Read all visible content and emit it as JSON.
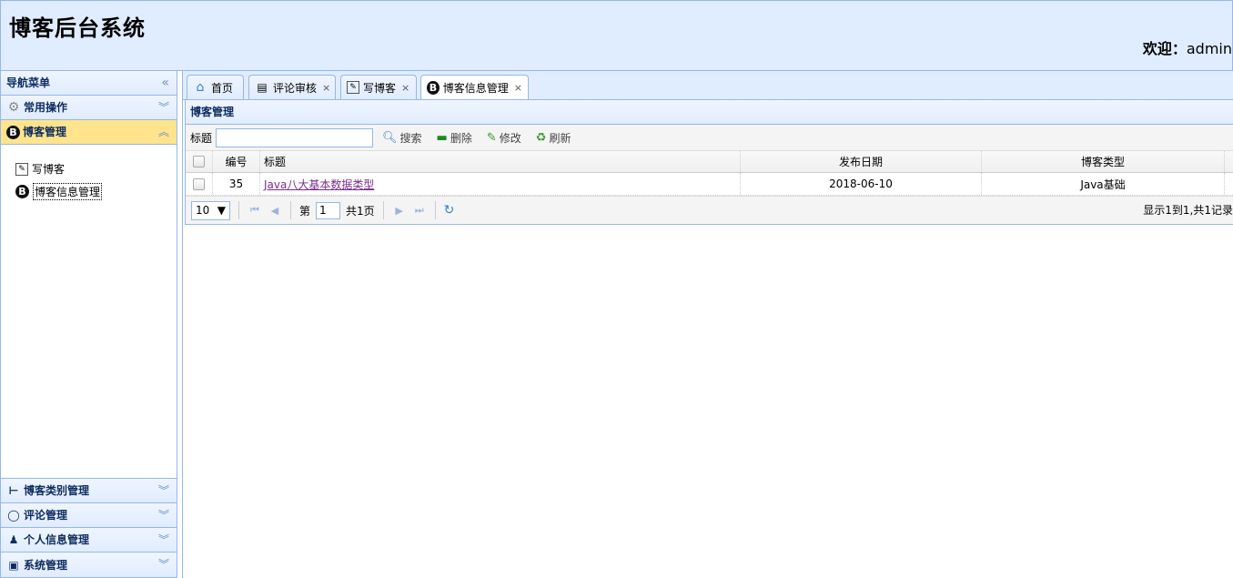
{
  "header": {
    "title": "博客后台系统",
    "welcome_prefix": "欢迎：",
    "user": "admin"
  },
  "sidebar": {
    "title": "导航菜单",
    "groups": [
      {
        "label": "常用操作",
        "icon": "gear-icon"
      },
      {
        "label": "博客管理",
        "icon": "blog-icon",
        "selected": true,
        "items": [
          {
            "label": "写博客",
            "icon": "edit-icon"
          },
          {
            "label": "博客信息管理",
            "icon": "blog-icon",
            "selected": true
          }
        ]
      },
      {
        "label": "博客类别管理",
        "icon": "category-icon"
      },
      {
        "label": "评论管理",
        "icon": "comment-icon"
      },
      {
        "label": "个人信息管理",
        "icon": "user-icon"
      },
      {
        "label": "系统管理",
        "icon": "settings-icon"
      }
    ]
  },
  "tabs": [
    {
      "label": "首页",
      "icon": "home-icon",
      "closable": false
    },
    {
      "label": "评论审核",
      "icon": "comment-review-icon",
      "closable": true
    },
    {
      "label": "写博客",
      "icon": "edit-icon",
      "closable": true
    },
    {
      "label": "博客信息管理",
      "icon": "blog-icon",
      "closable": true,
      "active": true
    }
  ],
  "panel": {
    "title": "博客管理",
    "search_label": "标题",
    "search_value": "",
    "buttons": {
      "search": "搜索",
      "delete": "删除",
      "edit": "修改",
      "refresh": "刷新"
    }
  },
  "grid": {
    "columns": [
      "编号",
      "标题",
      "发布日期",
      "博客类型"
    ],
    "rows": [
      {
        "id": "35",
        "title": "Java八大基本数据类型",
        "date": "2018-06-10",
        "type": "Java基础"
      }
    ]
  },
  "pager": {
    "page_size": "10",
    "page_prefix": "第",
    "page_number": "1",
    "page_total": "共1页",
    "info": "显示1到1,共1记录"
  },
  "colors": {
    "header_bg": "#e0ecff",
    "border": "#95b8e7",
    "selected_group": "#ffe48d",
    "link": "#7a2b8e"
  }
}
